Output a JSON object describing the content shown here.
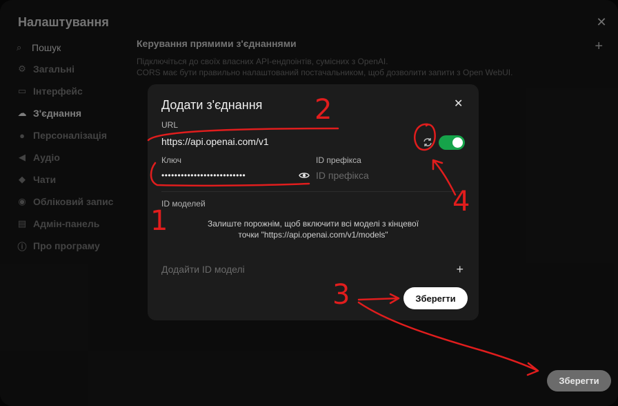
{
  "settings": {
    "title": "Налаштування",
    "search_label": "Пошук",
    "nav": [
      {
        "label": "Загальні",
        "icon": "gear-icon",
        "active": false
      },
      {
        "label": "Інтерфейс",
        "icon": "monitor-icon",
        "active": false
      },
      {
        "label": "З'єднання",
        "icon": "cloud-icon",
        "active": true
      },
      {
        "label": "Персоналізація",
        "icon": "person-icon",
        "active": false
      },
      {
        "label": "Аудіо",
        "icon": "speaker-icon",
        "active": false
      },
      {
        "label": "Чати",
        "icon": "chat-icon",
        "active": false
      },
      {
        "label": "Обліковий запис",
        "icon": "account-icon",
        "active": false
      },
      {
        "label": "Адмін-панель",
        "icon": "id-card-icon",
        "active": false
      },
      {
        "label": "Про програму",
        "icon": "info-icon",
        "active": false
      }
    ],
    "section_title": "Керування прямими з'єднаннями",
    "section_desc_1": "Підключіться до своїх власних API-ендпоінтів, сумісних з OpenAI.",
    "section_desc_2": "CORS має бути правильно налаштований постачальником, щоб дозволити запити з Open WebUI.",
    "save_label": "Зберегти"
  },
  "modal": {
    "title": "Додати з'єднання",
    "url_label": "URL",
    "url_value": "https://api.openai.com/v1",
    "toggle_on": true,
    "key_label": "Ключ",
    "key_masked": "••••••••••••••••••••••••••",
    "prefix_label": "ID префікса",
    "prefix_placeholder": "ID префікса",
    "models_label": "ID моделей",
    "models_empty_1": "Залиште порожнім, щоб включити всі моделі з кінцевої",
    "models_empty_2": "точки \"https://api.openai.com/v1/models\"",
    "add_model_placeholder": "Додайти ID моделі",
    "save_label": "Зберегти"
  },
  "annotations": {
    "labels": [
      "1",
      "2",
      "3",
      "4"
    ],
    "color": "#e11d1d"
  },
  "colors": {
    "toggle_on": "#16a34a",
    "modal_bg": "#1c1c1c",
    "panel_bg": "#171717"
  }
}
